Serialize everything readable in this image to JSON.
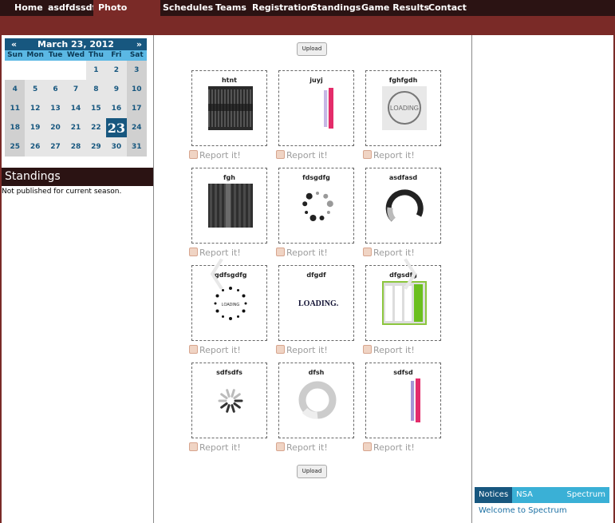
{
  "nav": {
    "items": [
      "Home",
      "asdfdssdf",
      "Photo Gallery",
      "Schedules",
      "Teams",
      "Registration",
      "Standings",
      "Game Results",
      "Contact"
    ],
    "active": "Photo Gallery"
  },
  "calendar": {
    "prev": "«",
    "title": "March 23, 2012",
    "next": "»",
    "dow": [
      "Sun",
      "Mon",
      "Tue",
      "Wed",
      "Thu",
      "Fri",
      "Sat"
    ],
    "weeks": [
      [
        "",
        "",
        "",
        "",
        "1",
        "2",
        "3"
      ],
      [
        "4",
        "5",
        "6",
        "7",
        "8",
        "9",
        "10"
      ],
      [
        "11",
        "12",
        "13",
        "14",
        "15",
        "16",
        "17"
      ],
      [
        "18",
        "19",
        "20",
        "21",
        "22",
        "23",
        "24"
      ],
      [
        "25",
        "26",
        "27",
        "28",
        "29",
        "30",
        "31"
      ]
    ],
    "today": "23"
  },
  "standings": {
    "heading": "Standings",
    "text": "Not published for current season."
  },
  "gallery": {
    "upload_label": "Upload",
    "report_label": "Report it!",
    "items": [
      {
        "title": "htnt"
      },
      {
        "title": "juyj"
      },
      {
        "title": "fghfgdh"
      },
      {
        "title": "fgh"
      },
      {
        "title": "fdsgdfg"
      },
      {
        "title": "asdfasd"
      },
      {
        "title": "fgdfsgdfg"
      },
      {
        "title": "dfgdf"
      },
      {
        "title": "dfgsdfg"
      },
      {
        "title": "sdfsdfs"
      },
      {
        "title": "dfsh"
      },
      {
        "title": "sdfsd"
      }
    ],
    "prev_arrow": "〈",
    "next_arrow": "〉",
    "thumb_text": {
      "loading": "LOADING",
      "loading2": "LOADING.",
      "loading3": "LOADING"
    }
  },
  "notices": {
    "tabs": [
      "Notices",
      "NSA CANADA",
      "Spectrum"
    ],
    "active": "Notices",
    "welcome": "Welcome to Spectrum"
  },
  "colors": {
    "dark": "#2b1313",
    "maroon": "#7a2a27",
    "blue": "#17577f",
    "lightblue": "#3ab0d6"
  }
}
